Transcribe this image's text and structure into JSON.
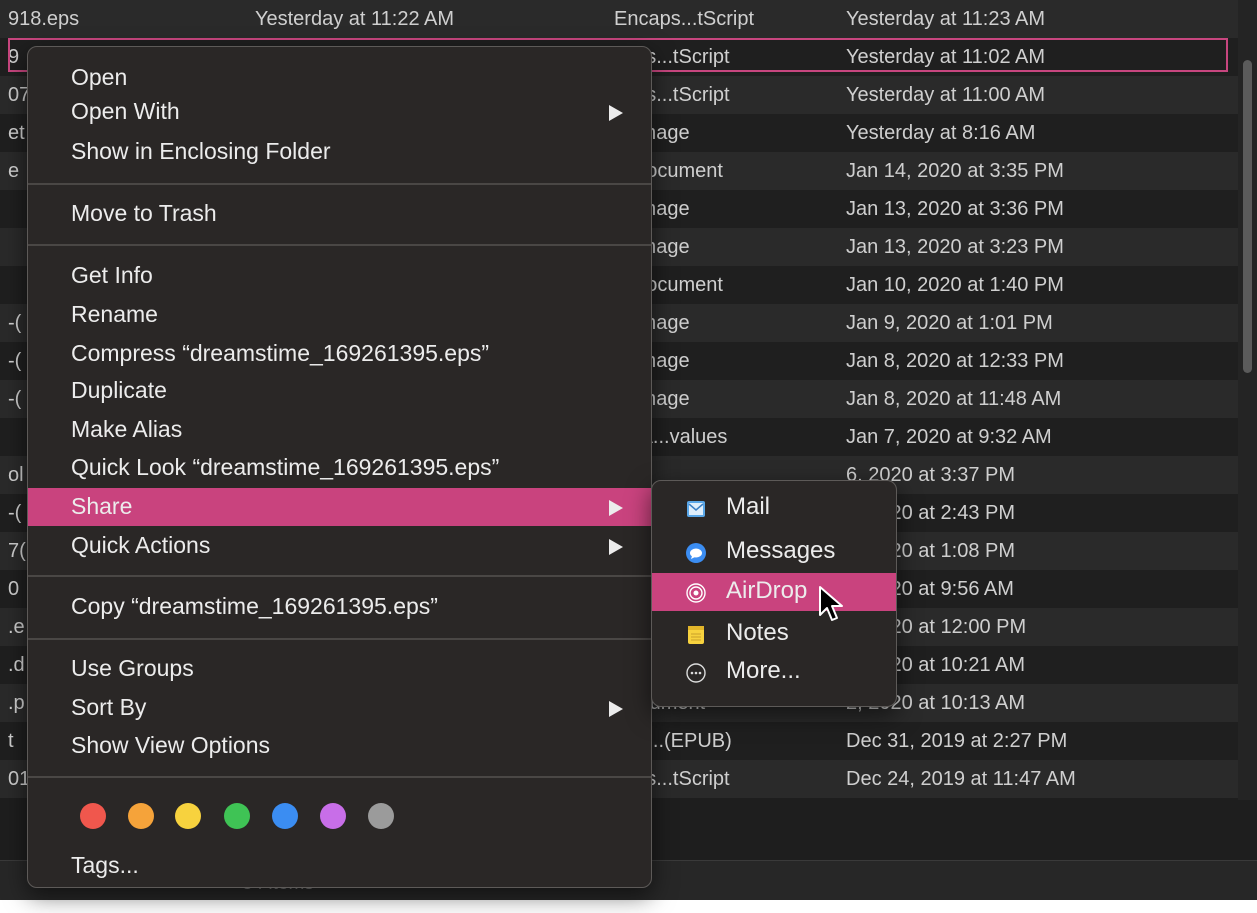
{
  "finder_rows": [
    {
      "name": "918.eps",
      "date_added": "Yesterday at 11:22 AM",
      "kind": "Encaps...tScript",
      "modified": "Yesterday at 11:23 AM"
    },
    {
      "name": "9",
      "date_added": "",
      "kind": "caps...tScript",
      "modified": "Yesterday at 11:02 AM"
    },
    {
      "name": "07",
      "date_added": "",
      "kind": "caps...tScript",
      "modified": "Yesterday at 11:00 AM"
    },
    {
      "name": "et",
      "date_added": "",
      "kind": "G image",
      "modified": "Yesterday at 8:16 AM"
    },
    {
      "name": "e",
      "date_added": "",
      "kind": "F Document",
      "modified": "Jan 14, 2020 at 3:35 PM"
    },
    {
      "name": "",
      "date_added": "",
      "kind": "G image",
      "modified": "Jan 13, 2020 at 3:36 PM"
    },
    {
      "name": "",
      "date_added": "",
      "kind": "G image",
      "modified": "Jan 13, 2020 at 3:23 PM"
    },
    {
      "name": "",
      "date_added": "",
      "kind": "F Document",
      "modified": "Jan 10, 2020 at 1:40 PM"
    },
    {
      "name": "-(",
      "date_added": "",
      "kind": "G image",
      "modified": "Jan 9, 2020 at 1:01 PM"
    },
    {
      "name": "-(",
      "date_added": "",
      "kind": "G image",
      "modified": "Jan 8, 2020 at 12:33 PM"
    },
    {
      "name": "-(",
      "date_added": "",
      "kind": "G image",
      "modified": "Jan 8, 2020 at 11:48 AM"
    },
    {
      "name": "",
      "date_added": "",
      "kind": "nma...values",
      "modified": "Jan 7, 2020 at 9:32 AM"
    },
    {
      "name": "ol",
      "date_added": "",
      "kind": "",
      "modified": "6, 2020 at 3:37 PM"
    },
    {
      "name": "-(",
      "date_added": "",
      "kind": "",
      "modified": "6, 2020 at 2:43 PM"
    },
    {
      "name": "7(",
      "date_added": "",
      "kind": "",
      "modified": "6, 2020 at 1:08 PM"
    },
    {
      "name": "0",
      "date_added": "",
      "kind": "",
      "modified": "6, 2020 at 9:56 AM"
    },
    {
      "name": ".e",
      "date_added": "",
      "kind": "",
      "modified": "2, 2020 at 12:00 PM"
    },
    {
      "name": ".d",
      "date_added": "",
      "kind": "",
      "modified": "2, 2020 at 10:21 AM"
    },
    {
      "name": ".p",
      "date_added": "",
      "kind": "Document",
      "modified": "2, 2020 at 10:13 AM"
    },
    {
      "name": "t",
      "date_added": "",
      "kind": "ctro...(EPUB)",
      "modified": "Dec 31, 2019 at 2:27 PM"
    },
    {
      "name": "01",
      "date_added": "",
      "kind": "caps...tScript",
      "modified": "Dec 24, 2019 at 11:47 AM"
    }
  ],
  "status": {
    "text": "34 items"
  },
  "context_menu": {
    "open": "Open",
    "open_with": "Open With",
    "show_enclosing": "Show in Enclosing Folder",
    "move_to_trash": "Move to Trash",
    "get_info": "Get Info",
    "rename": "Rename",
    "compress": "Compress “dreamstime_169261395.eps”",
    "duplicate": "Duplicate",
    "make_alias": "Make Alias",
    "quick_look": "Quick Look “dreamstime_169261395.eps”",
    "share": "Share",
    "quick_actions": "Quick Actions",
    "copy": "Copy “dreamstime_169261395.eps”",
    "use_groups": "Use Groups",
    "sort_by": "Sort By",
    "show_view_options": "Show View Options",
    "tags": "Tags...",
    "tag_colors": [
      "#f0574d",
      "#f5a33a",
      "#f7d23e",
      "#3fc355",
      "#3b8df2",
      "#c86ee8",
      "#9b9b9b"
    ]
  },
  "share_menu": {
    "mail": "Mail",
    "messages": "Messages",
    "airdrop": "AirDrop",
    "notes": "Notes",
    "more": "More..."
  },
  "colors": {
    "highlight": "#c9437e",
    "selection_outline": "#c8467f"
  }
}
